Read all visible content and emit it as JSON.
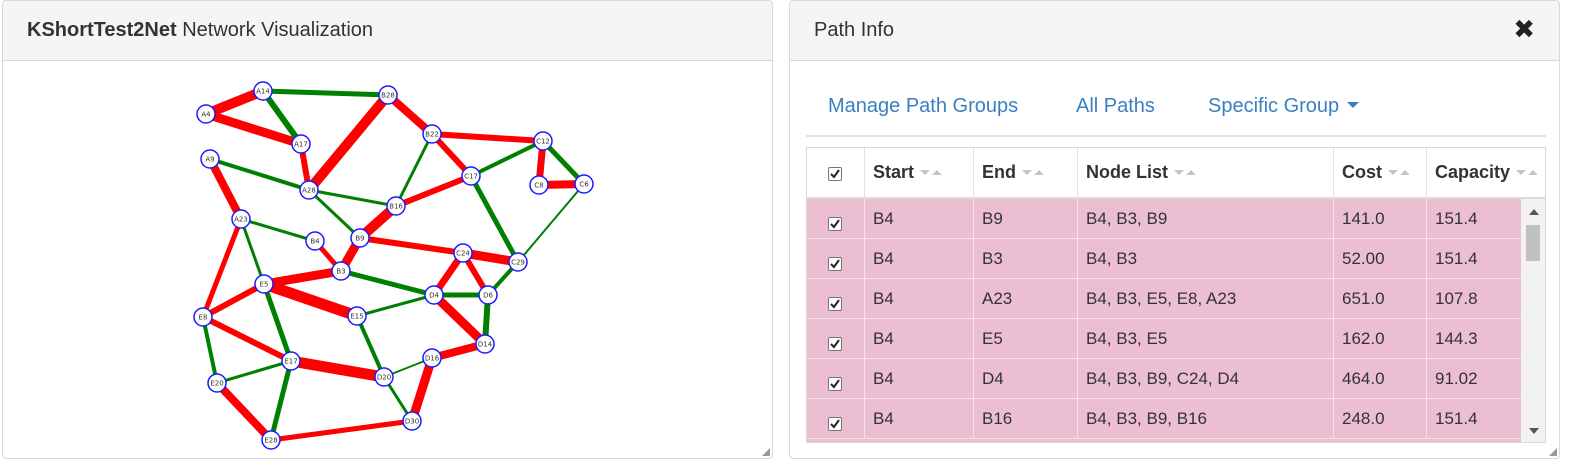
{
  "network_panel": {
    "title_bold": "KShortTest2Net",
    "title_rest": "Network Visualization"
  },
  "graph": {
    "nodes": [
      {
        "id": "A4"
      },
      {
        "id": "A14"
      },
      {
        "id": "B28"
      },
      {
        "id": "A9"
      },
      {
        "id": "A17"
      },
      {
        "id": "B22"
      },
      {
        "id": "C12"
      },
      {
        "id": "C17"
      },
      {
        "id": "C8"
      },
      {
        "id": "C6"
      },
      {
        "id": "A28"
      },
      {
        "id": "B16"
      },
      {
        "id": "A23"
      },
      {
        "id": "B4"
      },
      {
        "id": "B9"
      },
      {
        "id": "C24"
      },
      {
        "id": "C29"
      },
      {
        "id": "B3"
      },
      {
        "id": "E5"
      },
      {
        "id": "D4"
      },
      {
        "id": "D6"
      },
      {
        "id": "E15"
      },
      {
        "id": "E8"
      },
      {
        "id": "D14"
      },
      {
        "id": "D16"
      },
      {
        "id": "E17"
      },
      {
        "id": "D20"
      },
      {
        "id": "E20"
      },
      {
        "id": "D30"
      },
      {
        "id": "E28"
      }
    ],
    "colors": {
      "on_path": "#ff0000",
      "off_path": "#008000",
      "node_stroke": "#1a1aff",
      "node_fill": "#ffffff"
    }
  },
  "path_info": {
    "title": "Path Info",
    "close_icon": "✖",
    "nav": {
      "manage_groups": "Manage Path Groups",
      "all_paths": "All Paths",
      "specific_group": "Specific Group"
    },
    "columns": [
      "Start",
      "End",
      "Node List",
      "Cost",
      "Capacity"
    ],
    "rows": [
      {
        "start": "B4",
        "end": "B9",
        "nodes": "B4, B3, B9",
        "cost": "141.0",
        "capacity": "151.4"
      },
      {
        "start": "B4",
        "end": "B3",
        "nodes": "B4, B3",
        "cost": "52.00",
        "capacity": "151.4"
      },
      {
        "start": "B4",
        "end": "A23",
        "nodes": "B4, B3, E5, E8, A23",
        "cost": "651.0",
        "capacity": "107.8"
      },
      {
        "start": "B4",
        "end": "E5",
        "nodes": "B4, B3, E5",
        "cost": "162.0",
        "capacity": "144.3"
      },
      {
        "start": "B4",
        "end": "D4",
        "nodes": "B4, B3, B9, C24, D4",
        "cost": "464.0",
        "capacity": "91.02"
      },
      {
        "start": "B4",
        "end": "B16",
        "nodes": "B4, B3, B9, B16",
        "cost": "248.0",
        "capacity": "151.4"
      }
    ],
    "row_color": "#ebbfd1"
  }
}
